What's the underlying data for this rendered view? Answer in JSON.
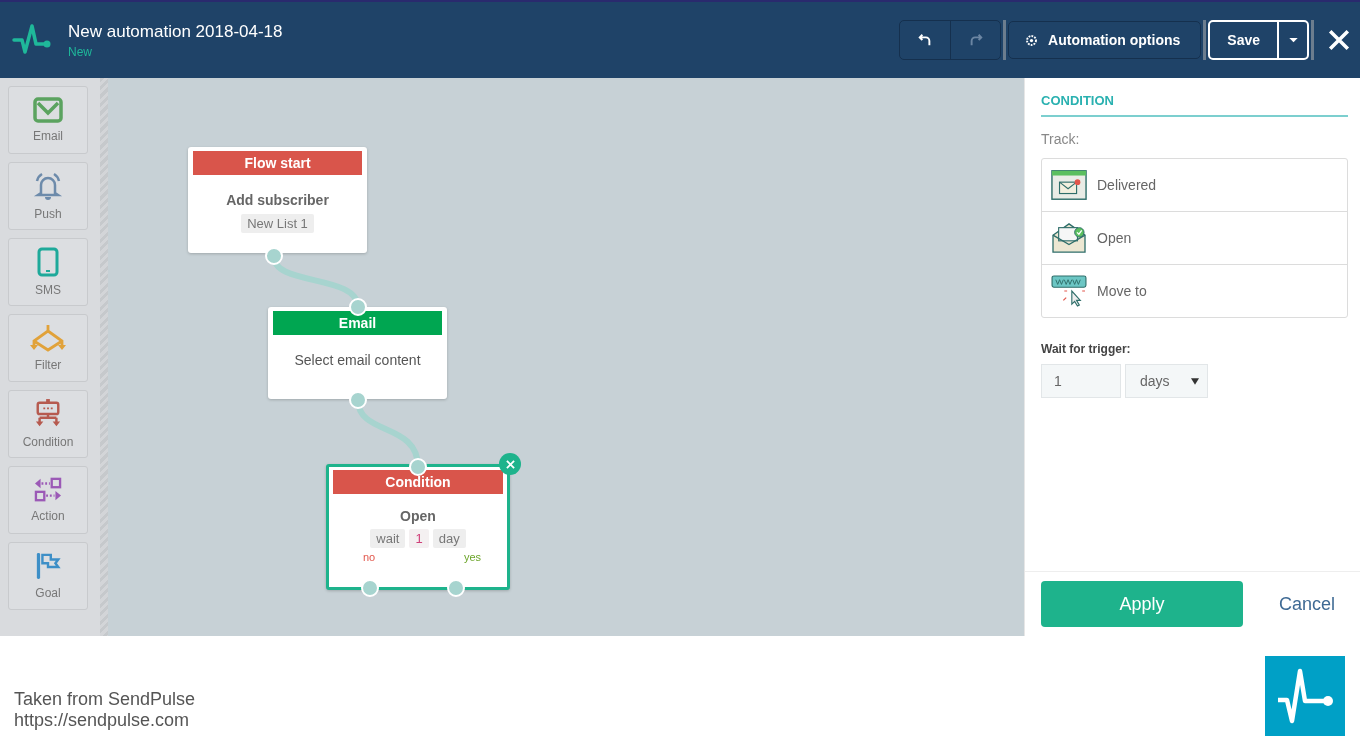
{
  "header": {
    "title": "New automation 2018-04-18",
    "status": "New",
    "history_buttons": [
      {
        "kind": "undo",
        "disabled": false
      },
      {
        "kind": "redo",
        "disabled": true
      }
    ],
    "options_button": "Automation options",
    "save_button": "Save"
  },
  "toolbox": [
    {
      "label": "Email"
    },
    {
      "label": "Push"
    },
    {
      "label": "SMS"
    },
    {
      "label": "Filter"
    },
    {
      "label": "Condition"
    },
    {
      "label": "Action"
    },
    {
      "label": "Goal"
    }
  ],
  "canvas": {
    "nodes": [
      {
        "kind": "start",
        "title": "Flow start",
        "selected": false,
        "text": "Add subscriber",
        "tag": "New List 1"
      },
      {
        "kind": "email",
        "title": "Email",
        "selected": false,
        "text": "Select email content"
      },
      {
        "kind": "condition",
        "title": "Condition",
        "selected": true,
        "text": "Open",
        "wait_label": "wait",
        "wait_value": "1",
        "wait_unit": "day",
        "branch_no": "no",
        "branch_yes": "yes"
      }
    ]
  },
  "panel": {
    "title": "CONDITION",
    "track_label": "Track:",
    "track_options": [
      {
        "label": "Delivered"
      },
      {
        "label": "Open"
      },
      {
        "label": "Move to"
      }
    ],
    "wait_label": "Wait for trigger:",
    "wait_value": "1",
    "wait_unit": "days",
    "apply_button": "Apply",
    "cancel_button": "Cancel"
  },
  "footer": {
    "caption": [
      "Taken from SendPulse",
      "https://sendpulse.com"
    ]
  }
}
